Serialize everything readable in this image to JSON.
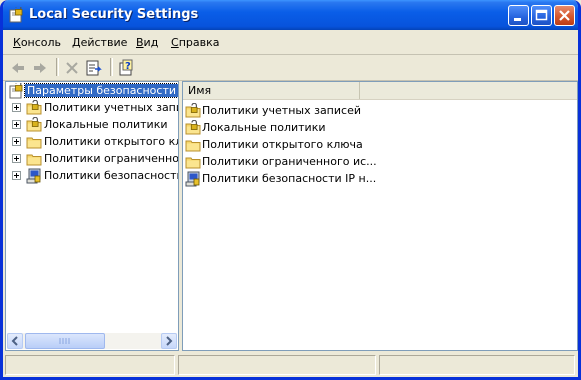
{
  "window": {
    "title": "Local Security Settings"
  },
  "menu": {
    "items": [
      "Консоль",
      "Действие",
      "Вид",
      "Справка"
    ]
  },
  "toolbar": {
    "buttons": [
      "back-icon",
      "forward-icon",
      "delete-icon",
      "export-list-icon",
      "help-icon"
    ]
  },
  "tree": {
    "root": {
      "label": "Параметры безопасности",
      "icon": "security-settings-icon",
      "selected": true
    },
    "items": [
      {
        "label": "Политики учетных записей",
        "icon": "folder-lock-icon"
      },
      {
        "label": "Локальные политики",
        "icon": "folder-lock-icon"
      },
      {
        "label": "Политики открытого ключа",
        "icon": "folder-icon"
      },
      {
        "label": "Политики ограниченного использования программ",
        "icon": "folder-icon"
      },
      {
        "label": "Политики безопасности IP на \"Локальный компьютер\"",
        "icon": "ip-security-icon"
      }
    ]
  },
  "list": {
    "columns": [
      "Имя"
    ],
    "rows": [
      {
        "name": "Политики учетных записей",
        "icon": "folder-lock-icon"
      },
      {
        "name": "Локальные политики",
        "icon": "folder-lock-icon"
      },
      {
        "name": "Политики открытого ключа",
        "icon": "folder-icon"
      },
      {
        "name": "Политики ограниченного ис...",
        "icon": "folder-icon"
      },
      {
        "name": "Политики безопасности IP н...",
        "icon": "ip-security-icon"
      }
    ]
  },
  "colors": {
    "titlebar": "#0a5ee8",
    "selection": "#316ac5",
    "folder": "#f6d66c"
  }
}
